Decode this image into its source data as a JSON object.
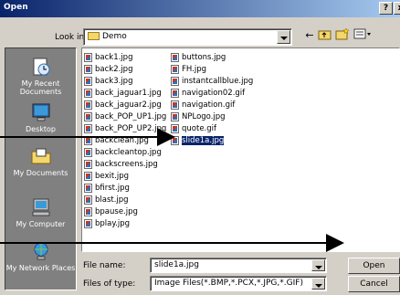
{
  "window": {
    "title": "Open"
  },
  "title_buttons": {
    "help": "?",
    "close": "x"
  },
  "look_in": {
    "label": "Look in:",
    "value": "Demo"
  },
  "places": [
    {
      "label": "My Recent Documents",
      "icon": "recent-documents-icon"
    },
    {
      "label": "Desktop",
      "icon": "desktop-icon"
    },
    {
      "label": "My Documents",
      "icon": "my-documents-icon"
    },
    {
      "label": "My Computer",
      "icon": "my-computer-icon"
    },
    {
      "label": "My Network Places",
      "icon": "network-places-icon"
    }
  ],
  "files": {
    "col1": [
      "back1.jpg",
      "back2.jpg",
      "back3.jpg",
      "back_jaguar1.jpg",
      "back_jaguar2.jpg",
      "back_POP_UP1.jpg",
      "back_POP_UP2.jpg",
      "backclean.jpg",
      "backcleantop.jpg",
      "backscreens.jpg",
      "bexit.jpg",
      "bfirst.jpg",
      "blast.jpg",
      "bpause.jpg",
      "bplay.jpg"
    ],
    "col2": [
      "buttons.jpg",
      "FH.jpg",
      "instantcallblue.jpg",
      "navigation02.gif",
      "navigation.gif",
      "NPLogo.jpg",
      "quote.gif",
      "slide1a.jpg"
    ],
    "selected": "slide1a.jpg"
  },
  "file_name": {
    "label": "File name:",
    "value": "slide1a.jpg"
  },
  "file_type": {
    "label": "Files of type:",
    "value": "Image Files(*.BMP,*.PCX,*.JPG,*.GIF)"
  },
  "buttons": {
    "open": "Open",
    "cancel": "Cancel"
  },
  "colors": {
    "titlebar": "#0a246a",
    "selection": "#0a246a",
    "annotation_arrow": "#000000"
  }
}
